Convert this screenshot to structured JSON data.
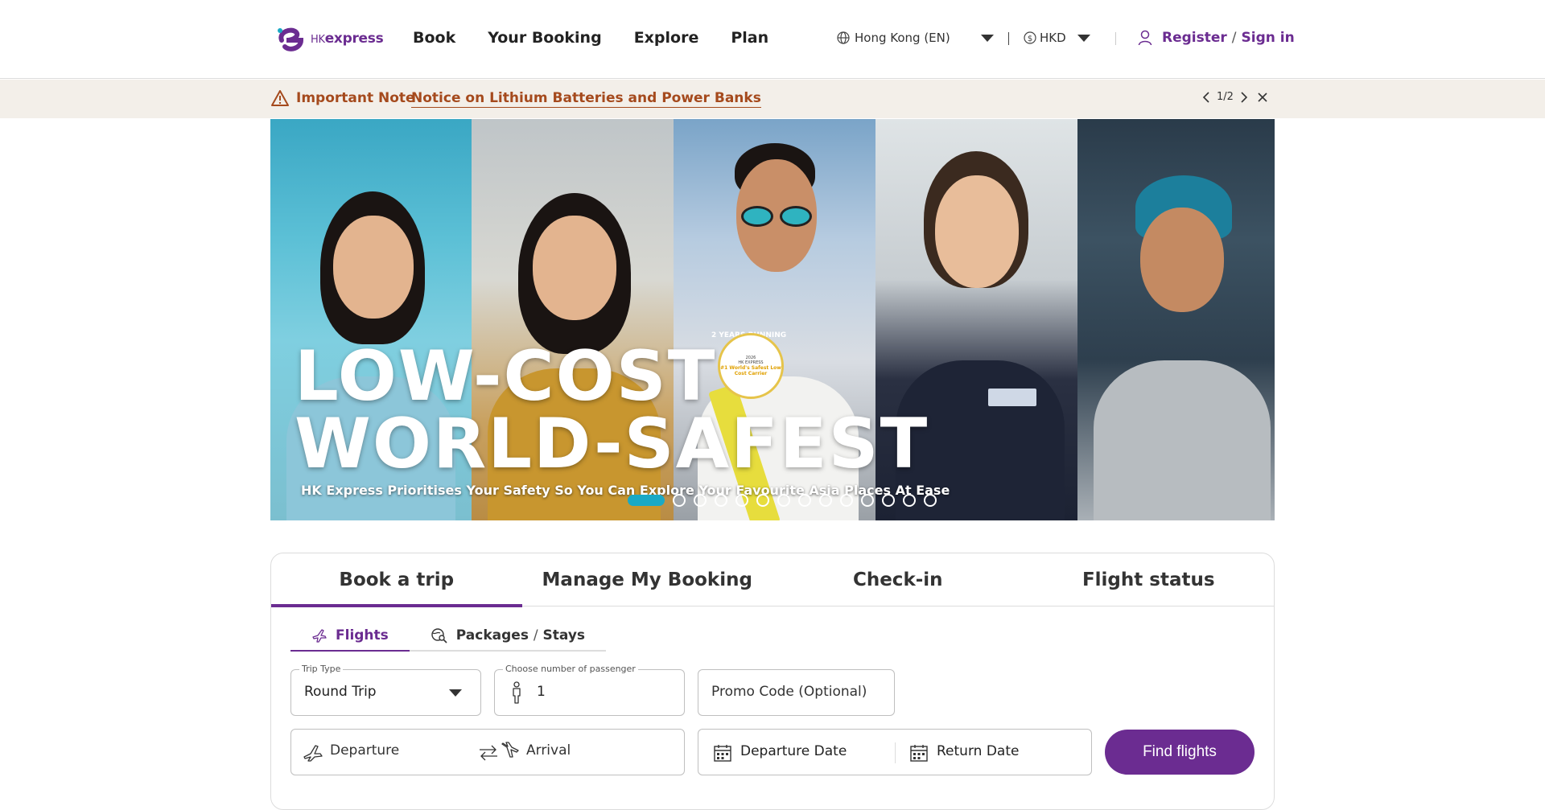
{
  "brand": {
    "logo_main": "express",
    "logo_prefix": "HK",
    "accent": "#6b2c91"
  },
  "nav": {
    "items": [
      "Book",
      "Your Booking",
      "Explore",
      "Plan"
    ]
  },
  "header": {
    "locale": "Hong Kong (EN)",
    "currency": "HKD",
    "register": "Register",
    "slash": "/",
    "signin": "Sign in"
  },
  "notice": {
    "label": "Important Note",
    "link": "Notice on Lithium Batteries and Power Banks",
    "pager": "1/2",
    "color": "#a54a1d"
  },
  "hero": {
    "title_line1": "LOW-COST",
    "title_line2": "WORLD-SAFEST",
    "subtitle": "HK Express Prioritises Your Safety So You Can Explore Your Favourite Asia Places At Ease",
    "badge_ring": "2 YEARS RUNNING",
    "badge_year": "2026",
    "badge_brand": "HK EXPRESS",
    "badge_title": "#1 World's Safest Low Cost Carrier",
    "slide_count": 14,
    "active_slide": 1,
    "dot_color": "#1aa9c5"
  },
  "booking": {
    "tabs": [
      "Book a trip",
      "Manage My Booking",
      "Check-in",
      "Flight status"
    ],
    "subtabs": {
      "flights": "Flights",
      "packages": "Packages",
      "slash": "/",
      "stays": "Stays"
    },
    "trip_type": {
      "label": "Trip Type",
      "value": "Round Trip"
    },
    "passengers": {
      "label": "Choose number of passenger",
      "value": "1"
    },
    "promo": {
      "placeholder": "Promo Code (Optional)"
    },
    "departure": {
      "placeholder": "Departure"
    },
    "arrival": {
      "placeholder": "Arrival"
    },
    "departure_date": {
      "placeholder": "Departure Date"
    },
    "return_date": {
      "placeholder": "Return Date"
    },
    "find_button": "Find flights"
  }
}
